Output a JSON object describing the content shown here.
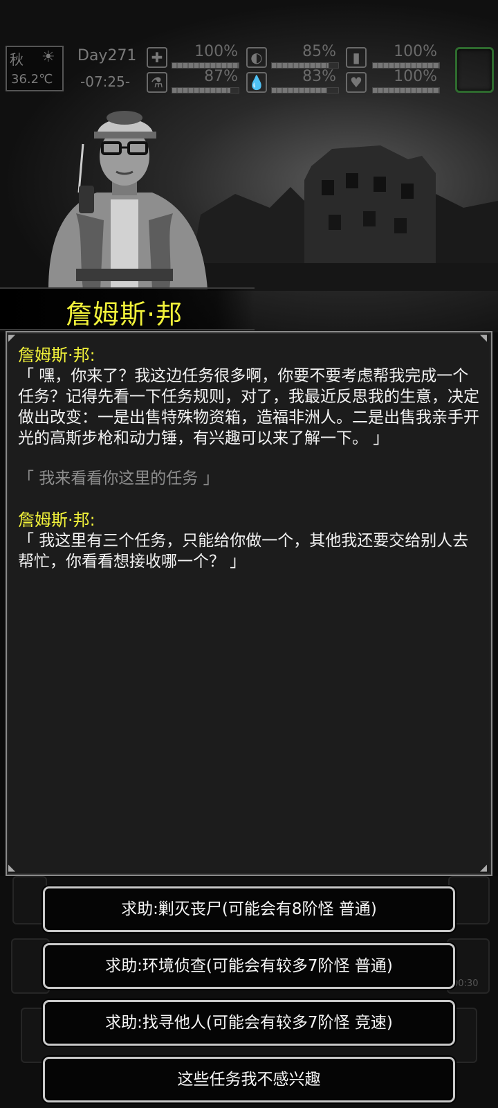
{
  "status_bar": {
    "season": "秋",
    "temperature": "36.2℃",
    "day": "Day271",
    "time": "-07:25-",
    "stats": {
      "medkit_pct": "100%",
      "stomach_pct": "85%",
      "stamina_pct": "100%",
      "flask_pct": "87%",
      "water_pct": "83%",
      "heart_pct": "100%"
    },
    "levels": {
      "medkit": 1.0,
      "stomach": 0.85,
      "stamina": 1.0,
      "flask": 0.87,
      "water": 0.83,
      "heart": 1.0
    },
    "icons": [
      "sun-icon",
      "medkit-icon",
      "stomach-icon",
      "stamina-icon",
      "flask-icon",
      "water-drop-icon",
      "heart-icon"
    ]
  },
  "npc": {
    "name": "詹姆斯·邦"
  },
  "dialog": {
    "entries": [
      {
        "speaker": "詹姆斯·邦:",
        "text": "「 嘿，你来了？我这边任务很多啊，你要不要考虑帮我完成一个任务？记得先看一下任务规则，对了，我最近反思我的生意，决定做出改变：一是出售特殊物资箱，造福非洲人。二是出售我亲手开光的高斯步枪和动力锤，有兴趣可以来了解一下。 」"
      },
      {
        "choice": "「 我来看看你这里的任务 」"
      },
      {
        "speaker": "詹姆斯·邦:",
        "text": "「 我这里有三个任务，只能给你做一个，其他我还要交给别人去帮忙，你看看想接收哪一个？ 」"
      }
    ]
  },
  "options": [
    {
      "label": "求助:剿灭丧尸(可能会有8阶怪  普通)"
    },
    {
      "label": "求助:环境侦查(可能会有较多7阶怪  普通)"
    },
    {
      "label": "求助:找寻他人(可能会有较多7阶怪  竞速)"
    },
    {
      "label": "这些任务我不感兴趣"
    }
  ],
  "background_ui": {
    "timer": "00:30"
  },
  "colors": {
    "npc_name": "#f2f23a",
    "speech": "#f2f2f2",
    "choice": "#8c8c8c",
    "panel_bg": "#1c1c1c",
    "button_border": "#c9c9c9"
  }
}
